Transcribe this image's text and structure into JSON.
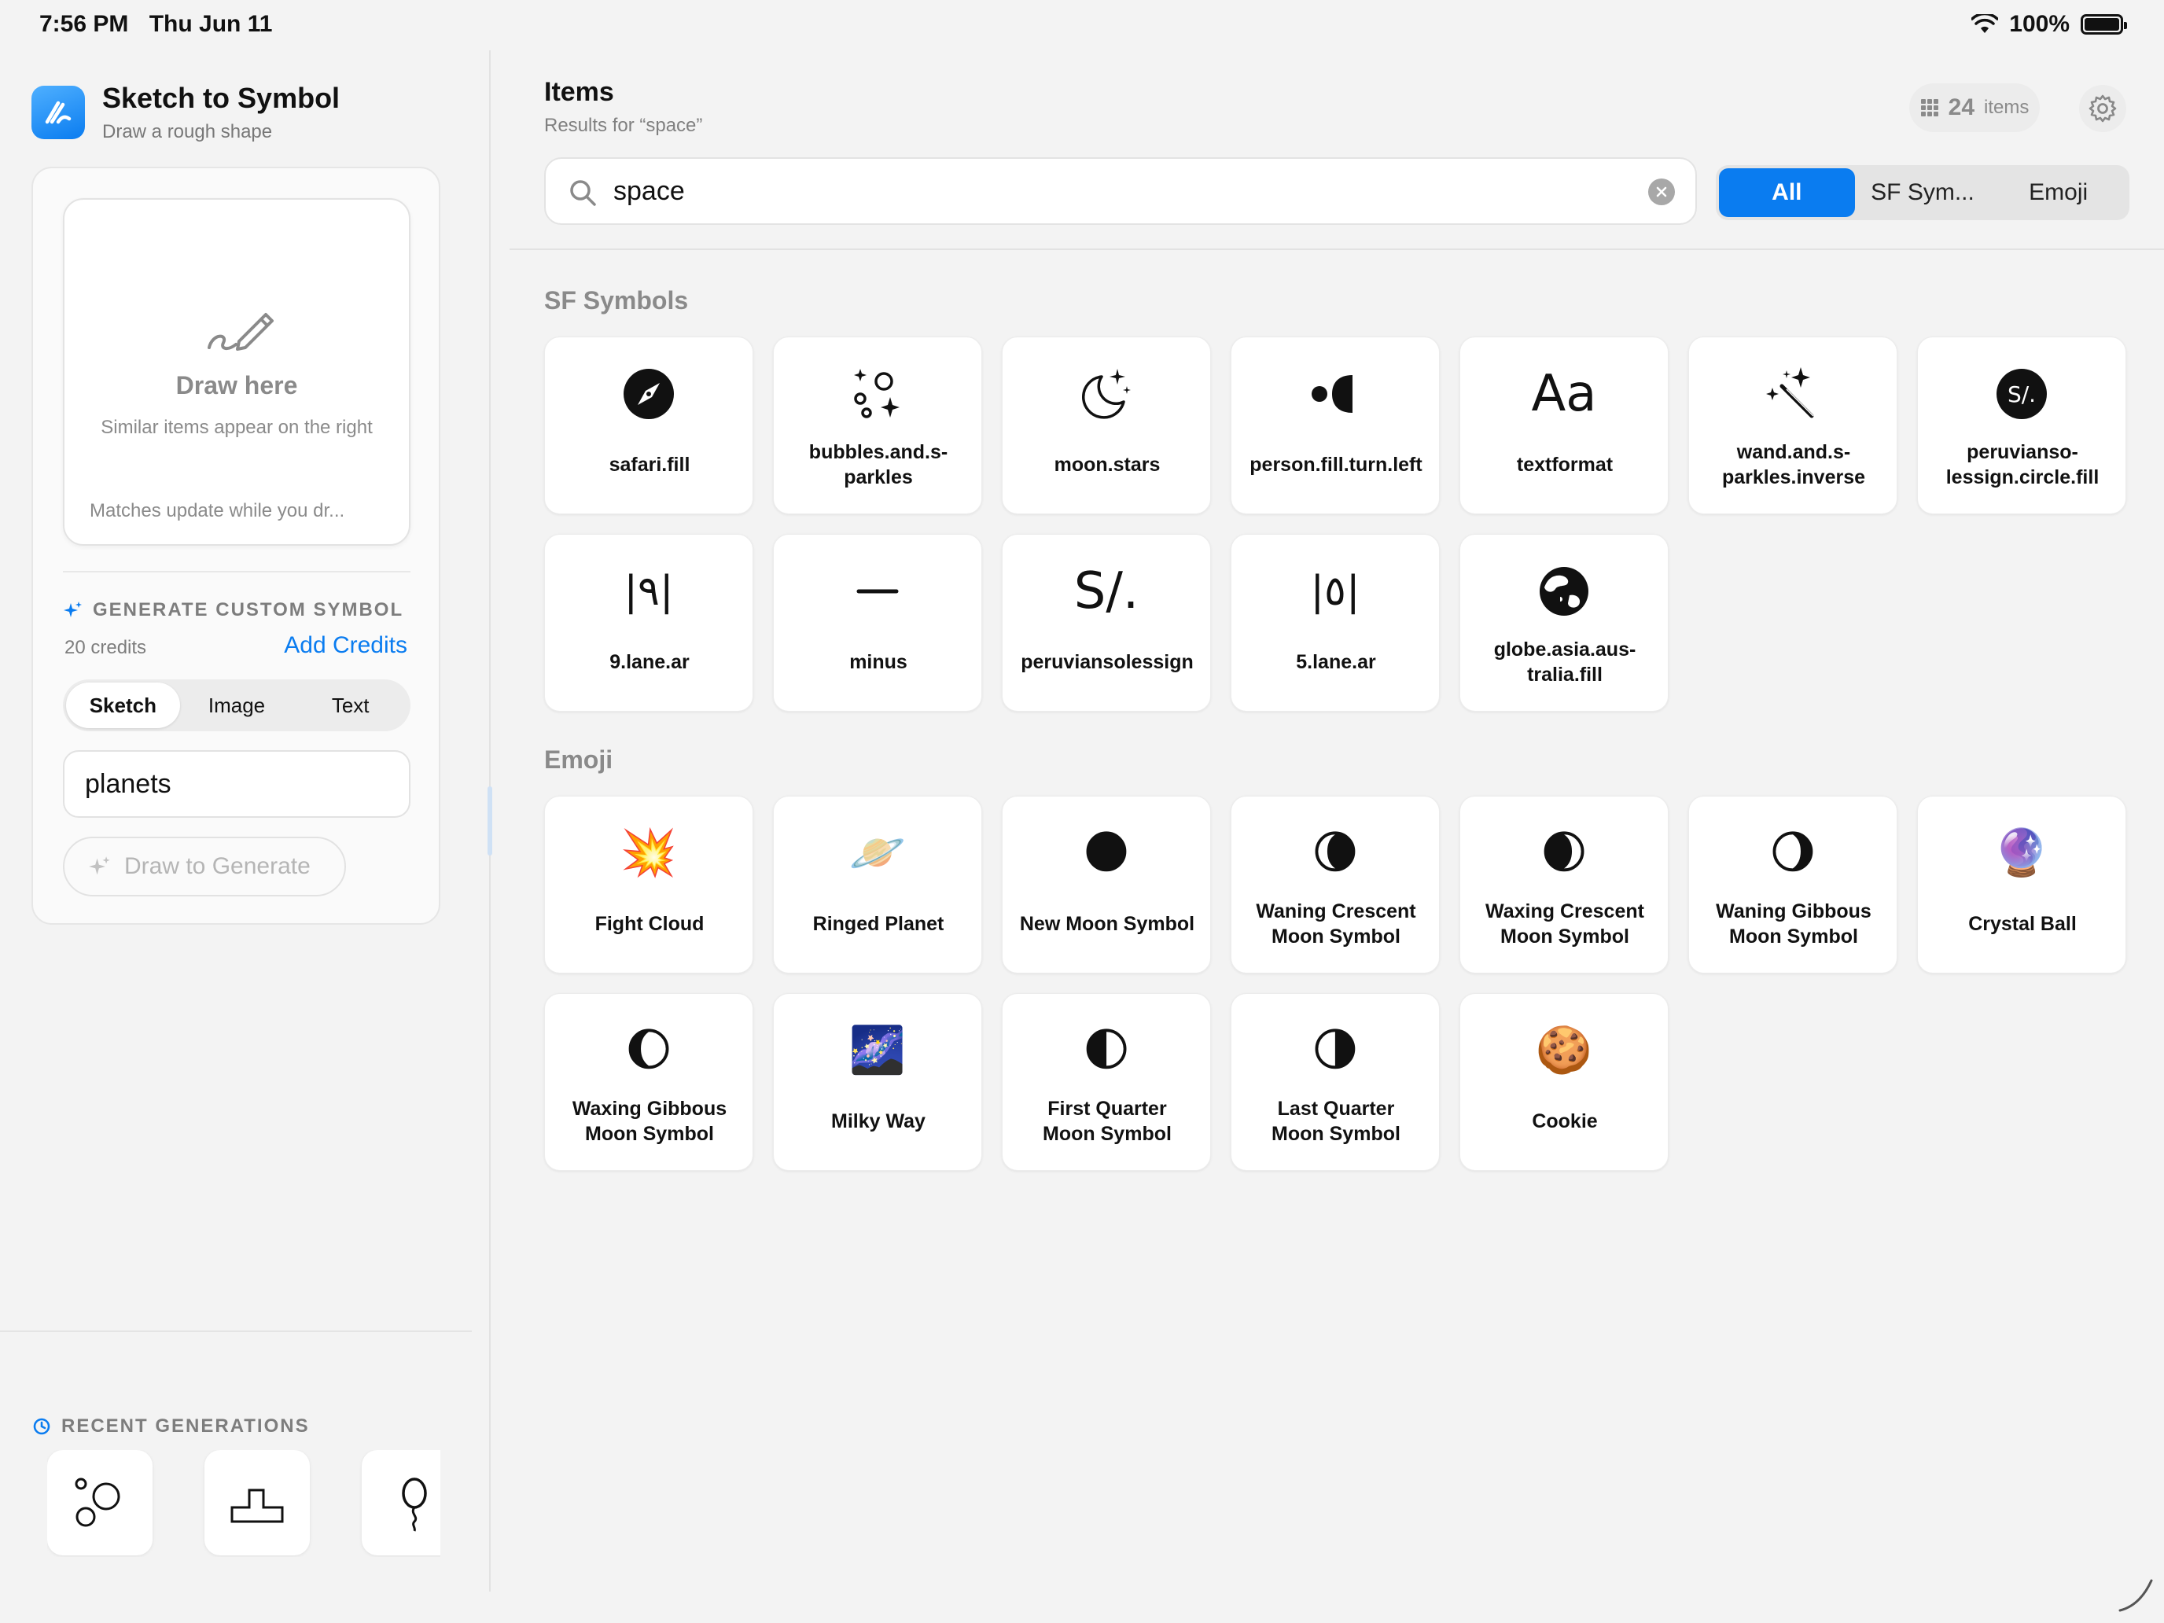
{
  "status": {
    "time": "7:56 PM",
    "date": "Thu Jun 11",
    "battery": "100%"
  },
  "sidebar": {
    "app_title": "Sketch to Symbol",
    "app_subtitle": "Draw a rough shape",
    "draw_title": "Draw here",
    "draw_subtitle": "Similar items appear on the right",
    "draw_footer": "Matches update while you dr...",
    "generate_heading": "GENERATE CUSTOM SYMBOL",
    "credits": "20 credits",
    "add_credits": "Add Credits",
    "modes": [
      {
        "label": "Sketch",
        "active": true
      },
      {
        "label": "Image",
        "active": false
      },
      {
        "label": "Text",
        "active": false
      }
    ],
    "prompt_value": "planets",
    "generate_button": "Draw to Generate",
    "recent_heading": "RECENT GENERATIONS"
  },
  "main": {
    "title": "Items",
    "subtitle": "Results for “space”",
    "count": "24",
    "count_label": "items",
    "search_value": "space",
    "filters": [
      {
        "label": "All",
        "active": true
      },
      {
        "label": "SF Sym...",
        "active": false
      },
      {
        "label": "Emoji",
        "active": false
      }
    ],
    "sf_heading": "SF Symbols",
    "sf_items": [
      {
        "label": "safari.fill",
        "icon": "safari-fill-icon"
      },
      {
        "label": "bubbles.and.s-\nparkles",
        "icon": "bubbles-sparkles-icon"
      },
      {
        "label": "moon.stars",
        "icon": "moon-stars-icon"
      },
      {
        "label": "person.fill.turn.left",
        "icon": "person-turn-left-icon"
      },
      {
        "label": "textformat",
        "icon": "textformat-icon",
        "glyph": "Aa"
      },
      {
        "label": "wand.and.s-\nparkles.inverse",
        "icon": "wand-sparkles-icon"
      },
      {
        "label": "peruvianso-\nlessign.circle.fill",
        "icon": "sol-circle-icon",
        "glyph": "S/."
      },
      {
        "label": "9.lane.ar",
        "icon": "lane-9-ar-icon",
        "glyph": "|٩|"
      },
      {
        "label": "minus",
        "icon": "minus-icon"
      },
      {
        "label": "peruviansolessign",
        "icon": "sol-sign-icon",
        "glyph": "S/."
      },
      {
        "label": "5.lane.ar",
        "icon": "lane-5-ar-icon",
        "glyph": "|٥|"
      },
      {
        "label": "globe.asia.aus-\ntralia.fill",
        "icon": "globe-asia-icon"
      }
    ],
    "emoji_heading": "Emoji",
    "emoji_items": [
      {
        "label": "Fight Cloud",
        "glyph": "💥"
      },
      {
        "label": "Ringed Planet",
        "glyph": "🪐"
      },
      {
        "label": "New Moon Symbol",
        "glyph": "🌑"
      },
      {
        "label": "Waning Crescent\nMoon Symbol",
        "glyph": "🌘"
      },
      {
        "label": "Waxing Crescent\nMoon Symbol",
        "glyph": "🌒"
      },
      {
        "label": "Waning Gibbous\nMoon Symbol",
        "glyph": "🌖"
      },
      {
        "label": "Crystal Ball",
        "glyph": "🔮"
      },
      {
        "label": "Waxing Gibbous\nMoon Symbol",
        "glyph": "🌔"
      },
      {
        "label": "Milky Way",
        "glyph": "🌌"
      },
      {
        "label": "First Quarter\nMoon Symbol",
        "glyph": "🌓"
      },
      {
        "label": "Last Quarter\nMoon Symbol",
        "glyph": "🌗"
      },
      {
        "label": "Cookie",
        "glyph": "🍪"
      }
    ]
  },
  "colors": {
    "accent": "#0a7cf0",
    "background": "#f3f3f3"
  }
}
